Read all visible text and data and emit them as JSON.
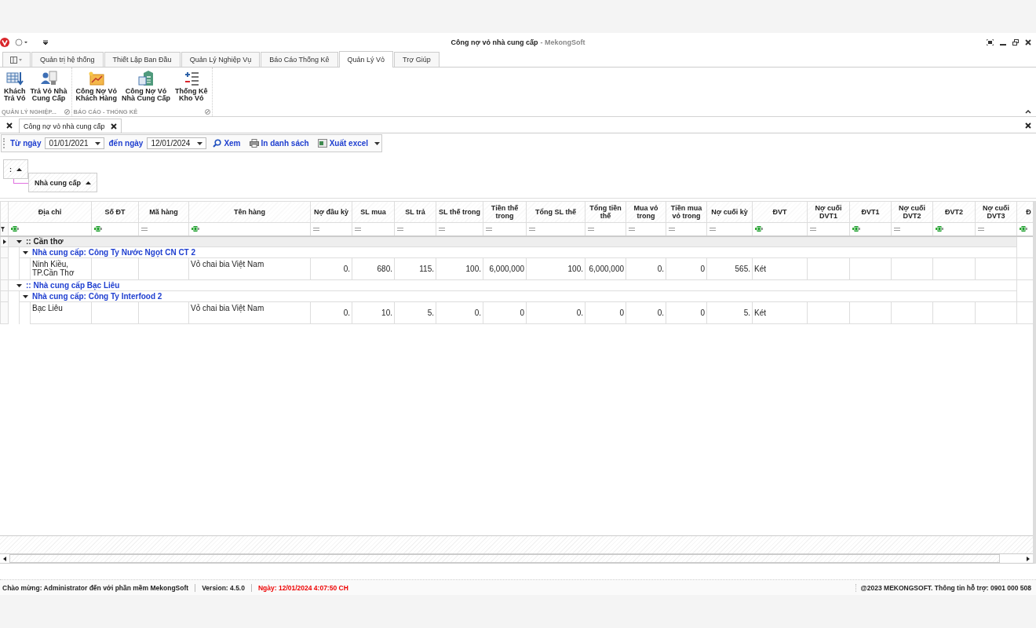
{
  "window": {
    "title": "Công nợ vỏ nhà cung cấp",
    "app_name": "- MekongSoft"
  },
  "ribbon": {
    "tabs": [
      {
        "label": "Quản trị hệ thống",
        "selected": false
      },
      {
        "label": "Thiết Lập Ban Đầu",
        "selected": false
      },
      {
        "label": "Quản Lý Nghiệp Vụ",
        "selected": false
      },
      {
        "label": "Báo Cáo Thống Kê",
        "selected": false
      },
      {
        "label": "Quản Lý Vỏ",
        "selected": true
      },
      {
        "label": "Trợ Giúp",
        "selected": false
      }
    ],
    "groups": [
      {
        "label": "QUẢN LÝ NGHIỆP...",
        "buttons": [
          {
            "kind": "table",
            "label": "Khách\nTrả Vỏ"
          },
          {
            "kind": "people",
            "label": "Trả Vỏ Nhà\nCung Cấp"
          }
        ]
      },
      {
        "label": "BÁO CÁO - THỐNG KÊ",
        "buttons": [
          {
            "kind": "chart",
            "label": "Công Nợ Vỏ\nKhách Hàng"
          },
          {
            "kind": "money",
            "label": "Công Nợ Vỏ\nNhà Cung Cấp"
          },
          {
            "kind": "list",
            "label": "Thống Kê\nKho Vỏ"
          }
        ]
      }
    ]
  },
  "doc_tabs": [
    {
      "label": "Công nợ vỏ nhà cung cấp",
      "selected": true
    }
  ],
  "toolbar": {
    "from_label": "Từ ngày",
    "from_value": "01/01/2021",
    "to_label": "đến ngày",
    "to_value": "12/01/2024",
    "buttons": [
      {
        "kind": "search",
        "label": "Xem"
      },
      {
        "kind": "print",
        "label": "In danh sách"
      },
      {
        "kind": "excel",
        "label": "Xuất excel"
      }
    ]
  },
  "group_panel": [
    {
      "label": ":"
    },
    {
      "label": "Nhà cung cấp"
    }
  ],
  "grid": {
    "columns": [
      {
        "label": "Địa chỉ",
        "kind": "text"
      },
      {
        "label": "Số ĐT",
        "kind": "text"
      },
      {
        "label": "Mã hàng",
        "kind": "number"
      },
      {
        "label": "Tên hàng",
        "kind": "text"
      },
      {
        "label": "Nợ đầu kỳ",
        "kind": "number"
      },
      {
        "label": "SL mua",
        "kind": "number"
      },
      {
        "label": "SL trả",
        "kind": "number"
      },
      {
        "label": "SL thế trong",
        "kind": "number"
      },
      {
        "label": "Tiền thế trong",
        "kind": "number"
      },
      {
        "label": "Tổng SL thế",
        "kind": "number"
      },
      {
        "label": "Tổng tiền thế",
        "kind": "number"
      },
      {
        "label": "Mua vỏ trong",
        "kind": "number"
      },
      {
        "label": "Tiền mua vỏ trong",
        "kind": "number"
      },
      {
        "label": "Nợ cuối kỳ",
        "kind": "number"
      },
      {
        "label": "ĐVT",
        "kind": "text"
      },
      {
        "label": "Nợ cuối DVT1",
        "kind": "number"
      },
      {
        "label": "ĐVT1",
        "kind": "text"
      },
      {
        "label": "Nợ cuối DVT2",
        "kind": "number"
      },
      {
        "label": "ĐVT2",
        "kind": "text"
      },
      {
        "label": "Nợ cuối DVT3",
        "kind": "number"
      },
      {
        "label": "Đ",
        "kind": "text"
      }
    ],
    "groups": [
      {
        "label": ":: Cần thơ",
        "expanded": true,
        "focused": true,
        "children": [
          {
            "label": "Nhà cung cấp: Công Ty Nước Ngọt CN CT 2",
            "expanded": true,
            "rows": [
              [
                "Ninh Kiều, TP.Cần Thơ",
                null,
                null,
                "Vỏ chai bia Việt Nam",
                "0.",
                "680.",
                "115.",
                "100.",
                "6,000,000",
                "100.",
                "6,000,000",
                "0.",
                "0",
                "565.",
                "Két",
                null,
                null,
                null,
                null,
                null,
                null
              ]
            ]
          }
        ]
      },
      {
        "label": ":: Nhà cung cấp Bạc Liêu",
        "expanded": true,
        "focused": false,
        "children": [
          {
            "label": "Nhà cung cấp: Công Ty Interfood 2",
            "expanded": true,
            "rows": [
              [
                "Bạc Liêu",
                null,
                null,
                "Vỏ chai bia Việt Nam",
                "0.",
                "10.",
                "5.",
                "0.",
                "0",
                "0.",
                "0",
                "0.",
                "0",
                "5.",
                "Két",
                null,
                null,
                null,
                null,
                null,
                null
              ]
            ]
          }
        ]
      }
    ]
  },
  "status_bar": {
    "welcome": "Chào mừng: Administrator đến với phần mềm MekongSoft",
    "version": "Version: 4.5.0",
    "date": "Ngày: 12/01/2024 4:07:50 CH",
    "copyright": "@2023 MEKONGSOFT. Thông tin hỗ trợ: 0901 000 508"
  }
}
